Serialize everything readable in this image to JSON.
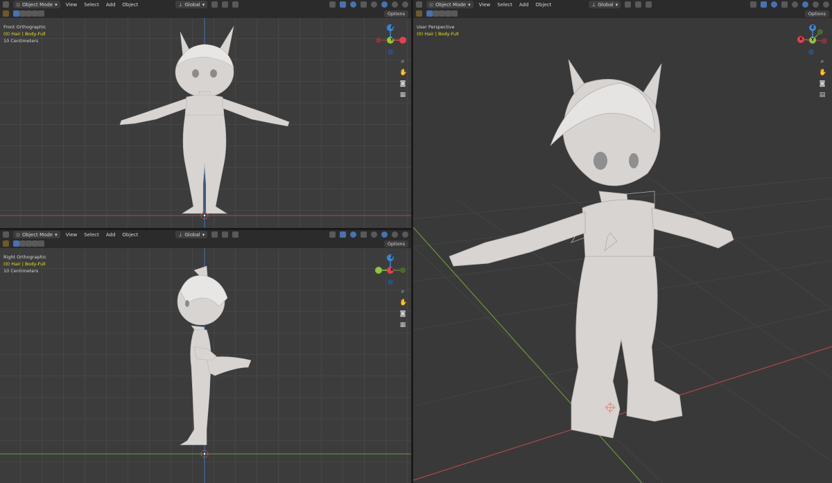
{
  "viewports": {
    "front": {
      "header": {
        "mode": "Object Mode",
        "menu": [
          "View",
          "Select",
          "Add",
          "Object"
        ],
        "orientation": "Global",
        "options": "Options"
      },
      "view_name": "Front Orthographic",
      "object_info": "(0) Hair | Body-Full",
      "scale": "10 Centimeters",
      "gizmo": {
        "top": "Z",
        "center": "Y",
        "left": "",
        "right": ""
      }
    },
    "right": {
      "header": {
        "mode": "Object Mode",
        "menu": [
          "View",
          "Select",
          "Add",
          "Object"
        ],
        "orientation": "Global",
        "options": "Options"
      },
      "view_name": "Right Orthographic",
      "object_info": "(0) Hair | Body-Full",
      "scale": "10 Centimeters",
      "gizmo": {
        "top": "Z",
        "center": "X",
        "left": "",
        "right": ""
      }
    },
    "user": {
      "header": {
        "mode": "Object Mode",
        "menu": [
          "View",
          "Select",
          "Add",
          "Object"
        ],
        "orientation": "Global",
        "options": "Options"
      },
      "view_name": "User Perspective",
      "object_info": "(0) Hair | Body-Full",
      "gizmo": {
        "top": "Z",
        "center": "Y",
        "left": "X"
      }
    }
  },
  "colors": {
    "x_axis": "#e8404f",
    "y_axis": "#8cc73a",
    "z_axis": "#3b85d8",
    "object_info": "#e5e21e",
    "model": "#d8d4d2"
  },
  "icons": [
    "cursor-icon",
    "object-mode-icon",
    "pivot-icon",
    "snap-icon",
    "proportional-icon",
    "overlay-icon",
    "shading-solid-icon",
    "zoom-icon",
    "pan-icon",
    "camera-icon",
    "grid-icon"
  ]
}
